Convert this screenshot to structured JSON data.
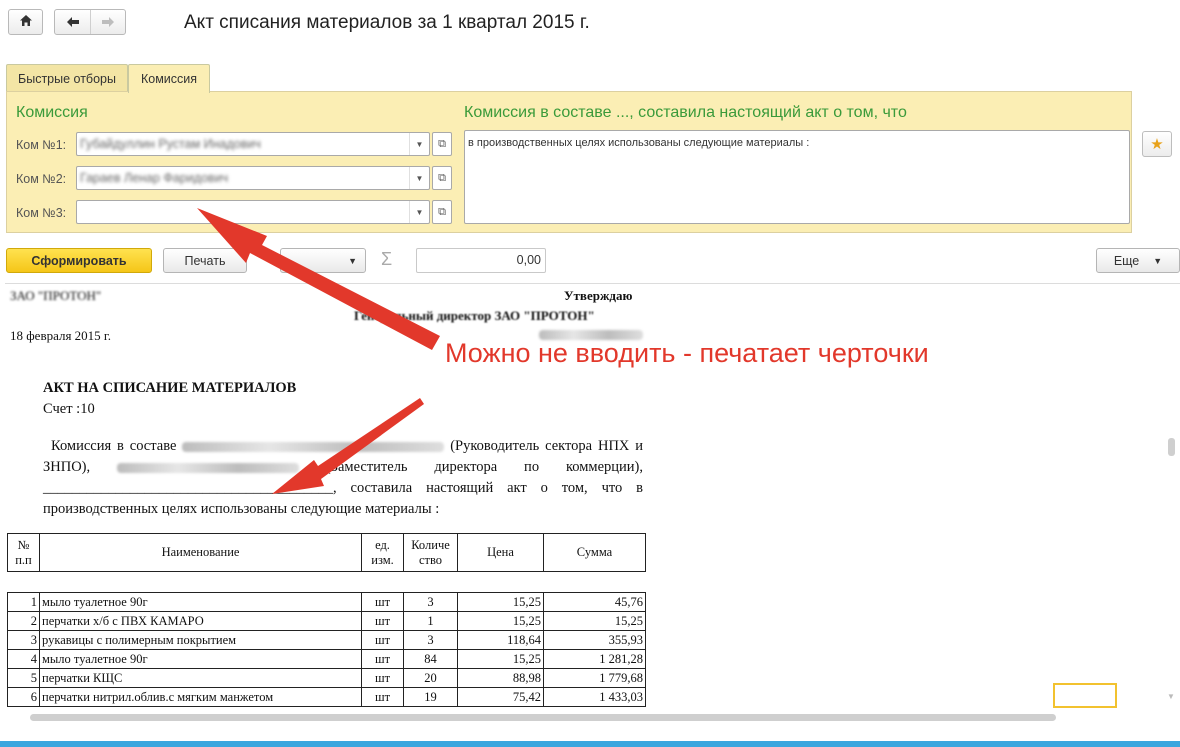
{
  "window": {
    "title": "Акт списания материалов за 1 квартал 2015 г.",
    "home_icon": "home-icon",
    "back_icon": "arrow-left-icon",
    "forward_icon": "arrow-right-icon"
  },
  "tabs": [
    {
      "label": "Быстрые отборы",
      "active": false
    },
    {
      "label": "Комиссия",
      "active": true
    }
  ],
  "commission": {
    "section_title": "Комиссия",
    "members": [
      {
        "label": "Ком №1:",
        "value": "Губайдуллин Рустам Инадович"
      },
      {
        "label": "Ком №2:",
        "value": "Гараев Ленар Фаридович"
      },
      {
        "label": "Ком №3:",
        "value": ""
      }
    ],
    "text_title": "Комиссия в составе ..., составила настоящий акт о том, что",
    "text_value": "в производственных целях использованы следующие материалы :"
  },
  "toolbar": {
    "form_label": "Сформировать",
    "print_label": "Печать",
    "more_menu_label": "Еще",
    "sum_value": "0,00"
  },
  "document": {
    "org": "ЗАО \"ПРОТОН\"",
    "approve": "Утверждаю",
    "director": "Генеральный директор ЗАО \"ПРОТОН\"",
    "date": "18 февраля 2015 г.",
    "heading": "АКТ НА СПИСАНИЕ МАТЕРИАЛОВ",
    "account": "Счет :10",
    "para_prefix": "Комиссия в составе",
    "role1": "(Руководитель сектора НПХ и ЗНПО),",
    "role2": "(Заместитель директора по коммерции),",
    "blank_line": "________________________________________",
    "para_suffix": ", составила настоящий акт о том, что в производственных целях использованы следующие материалы :",
    "columns": [
      "№ п.п",
      "Наименование",
      "ед. изм.",
      "Количе ство",
      "Цена",
      "Сумма"
    ],
    "rows": [
      {
        "n": "1",
        "name": "мыло туалетное 90г",
        "unit": "шт",
        "qty": "3",
        "price": "15,25",
        "sum": "45,76"
      },
      {
        "n": "2",
        "name": "перчатки х/б с ПВХ КАМАРО",
        "unit": "шт",
        "qty": "1",
        "price": "15,25",
        "sum": "15,25"
      },
      {
        "n": "3",
        "name": "рукавицы с полимерным покрытием",
        "unit": "шт",
        "qty": "3",
        "price": "118,64",
        "sum": "355,93"
      },
      {
        "n": "4",
        "name": "мыло туалетное 90г",
        "unit": "шт",
        "qty": "84",
        "price": "15,25",
        "sum": "1 281,28"
      },
      {
        "n": "5",
        "name": "перчатки КЩС",
        "unit": "шт",
        "qty": "20",
        "price": "88,98",
        "sum": "1 779,68"
      },
      {
        "n": "6",
        "name": "перчатки нитрил.облив.с мягким манжетом",
        "unit": "шт",
        "qty": "19",
        "price": "75,42",
        "sum": "1 433,03"
      }
    ]
  },
  "annotation": "Можно не вводить - печатает черточки",
  "colors": {
    "panel_bg": "#fbeeb4",
    "section_title": "#3a9a3a",
    "primary_button": "#f5c618",
    "annotation": "#e2382b",
    "accent_bar": "#3aa6de"
  }
}
